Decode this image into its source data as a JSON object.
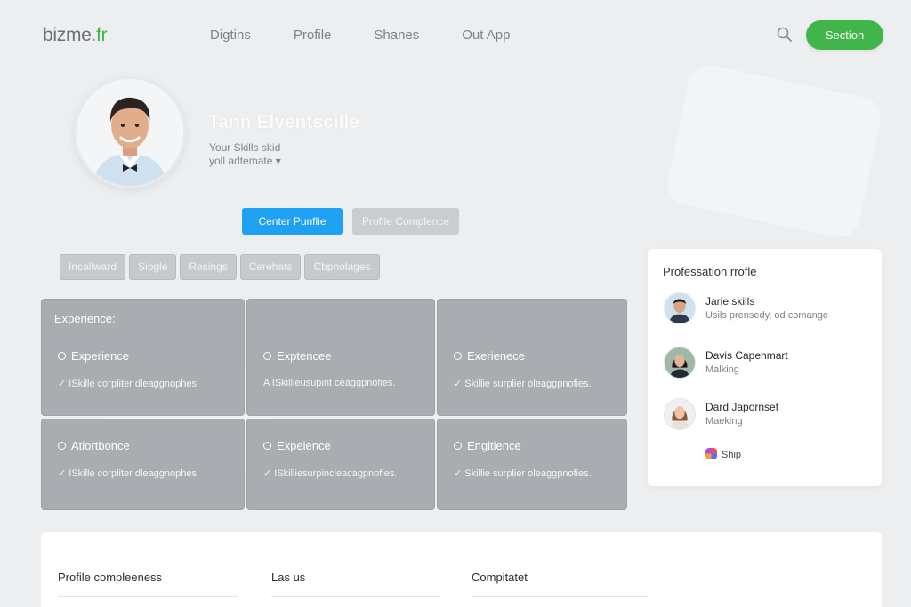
{
  "brand": {
    "name_main": "bizme",
    "name_accent": ".fr"
  },
  "nav": {
    "items": [
      "Digtins",
      "Profile",
      "Shanes",
      "Out App"
    ]
  },
  "header": {
    "primary_button": "Section"
  },
  "profile": {
    "name": "Tann Elventscille",
    "subtitle": "Your Skills skid",
    "dropdown": "yoll adtemate ▾",
    "button_primary": "Center Punflie",
    "button_secondary": "Profile Complence"
  },
  "chips": [
    "Incallward",
    "Siogle",
    "Resings",
    "Cerehats",
    "Cbpnolages"
  ],
  "cards": {
    "heading": "Experience:",
    "items": [
      {
        "title": "Experience",
        "icon": "circle-icon",
        "line": "✓ ISkille corpliter dleaggnophes."
      },
      {
        "title": "Exptencee",
        "icon": "circle-icon",
        "line": "A ISkillieusupint ceaggpnofies."
      },
      {
        "title": "Exerienece",
        "icon": "circle-icon",
        "line": "✓ Skillie surplier oleaggpnofies."
      },
      {
        "title": "Atiortbonce",
        "icon": "circle-icon",
        "line": "✓ ISkille corpliter dleaggnophes."
      },
      {
        "title": "Expeience",
        "icon": "circle-icon",
        "line": "✓ ISkilliesurpincleacagpnofies."
      },
      {
        "title": "Engitience",
        "icon": "circle-icon",
        "line": "✓ Skillie surplier oleaggpnofies."
      }
    ]
  },
  "sidebar": {
    "title": "Professation rrofle",
    "people": [
      {
        "name": "Jarie skills",
        "role": "Usils prensedy, od comange"
      },
      {
        "name": "Davis Capenmart",
        "role": "Malking"
      },
      {
        "name": "Dard Japornset",
        "role": "Maeking"
      }
    ],
    "link": "Ship"
  },
  "bottom": {
    "columns": [
      "Profile compleeness",
      "Las us",
      "Compitatet"
    ]
  },
  "colors": {
    "accent_green": "#3fb54a",
    "accent_blue": "#1ea1f2",
    "card_grey": "#a9acb0"
  }
}
